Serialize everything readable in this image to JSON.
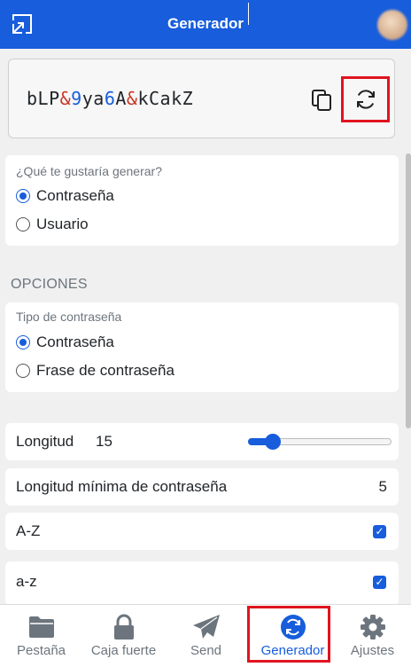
{
  "header": {
    "title": "Generador"
  },
  "password": {
    "segments": [
      {
        "text": "bLP",
        "kind": "n"
      },
      {
        "text": "&",
        "kind": "s"
      },
      {
        "text": "9",
        "kind": "d"
      },
      {
        "text": "ya",
        "kind": "n"
      },
      {
        "text": "6",
        "kind": "d"
      },
      {
        "text": "A",
        "kind": "n"
      },
      {
        "text": "&",
        "kind": "s"
      },
      {
        "text": "kCakZ",
        "kind": "n"
      }
    ]
  },
  "generate": {
    "question": "¿Qué te gustaría generar?",
    "options": [
      {
        "label": "Contraseña",
        "selected": true
      },
      {
        "label": "Usuario",
        "selected": false
      }
    ]
  },
  "options_heading": "OPCIONES",
  "password_type": {
    "question": "Tipo de contraseña",
    "options": [
      {
        "label": "Contraseña",
        "selected": true
      },
      {
        "label": "Frase de contraseña",
        "selected": false
      }
    ]
  },
  "length": {
    "label": "Longitud",
    "value": "15",
    "slider_fraction": 0.13
  },
  "min_length": {
    "label": "Longitud mínima de contraseña",
    "value": "5"
  },
  "toggles": [
    {
      "label": "A-Z",
      "checked": true
    },
    {
      "label": "a-z",
      "checked": true
    }
  ],
  "nav": [
    {
      "label": "Pestaña",
      "icon": "folder-icon",
      "active": false
    },
    {
      "label": "Caja fuerte",
      "icon": "lock-icon",
      "active": false
    },
    {
      "label": "Send",
      "icon": "paper-plane-icon",
      "active": false
    },
    {
      "label": "Generador",
      "icon": "refresh-icon",
      "active": true
    },
    {
      "label": "Ajustes",
      "icon": "gear-icon",
      "active": false
    }
  ],
  "colors": {
    "brand": "#175ddc",
    "special_char": "#c83522",
    "highlight": "#e0141e"
  }
}
